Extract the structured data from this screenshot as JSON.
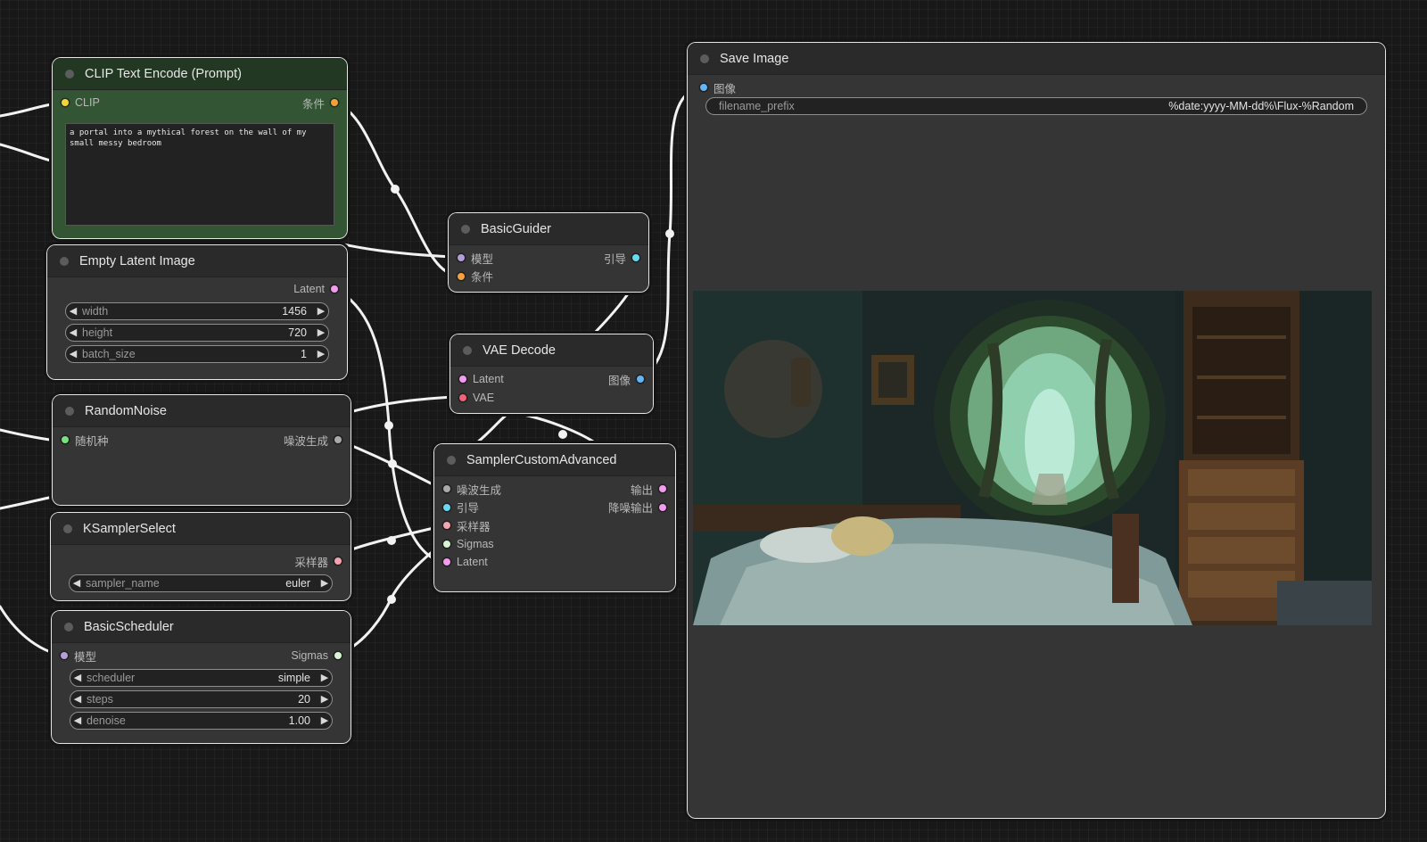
{
  "nodes": {
    "clip_text_encode": {
      "title": "CLIP Text Encode (Prompt)",
      "input": "CLIP",
      "output": "条件",
      "prompt_text": "a portal into a mythical forest on the wall of my small messy bedroom"
    },
    "empty_latent": {
      "title": "Empty Latent Image",
      "output": "Latent",
      "widgets": [
        {
          "label": "width",
          "value": "1456"
        },
        {
          "label": "height",
          "value": "720"
        },
        {
          "label": "batch_size",
          "value": "1"
        }
      ]
    },
    "random_noise": {
      "title": "RandomNoise",
      "input": "随机种",
      "output": "噪波生成"
    },
    "ksampler_select": {
      "title": "KSamplerSelect",
      "output": "采样器",
      "widgets": [
        {
          "label": "sampler_name",
          "value": "euler"
        }
      ]
    },
    "basic_scheduler": {
      "title": "BasicScheduler",
      "input": "模型",
      "output": "Sigmas",
      "widgets": [
        {
          "label": "scheduler",
          "value": "simple"
        },
        {
          "label": "steps",
          "value": "20"
        },
        {
          "label": "denoise",
          "value": "1.00"
        }
      ]
    },
    "basic_guider": {
      "title": "BasicGuider",
      "inputs": [
        "模型",
        "条件"
      ],
      "output": "引导"
    },
    "vae_decode": {
      "title": "VAE Decode",
      "inputs": [
        "Latent",
        "VAE"
      ],
      "output": "图像"
    },
    "sampler_custom_advanced": {
      "title": "SamplerCustomAdvanced",
      "inputs": [
        "噪波生成",
        "引导",
        "采样器",
        "Sigmas",
        "Latent"
      ],
      "outputs": [
        "输出",
        "降噪输出"
      ]
    },
    "save_image": {
      "title": "Save Image",
      "input": "图像",
      "filename_label": "filename_prefix",
      "filename_value": "%date:yyyy-MM-dd%\\Flux-%Random"
    }
  },
  "colors": {
    "canvas": "#181818",
    "node_body": "#353535",
    "clip_node": "#335533",
    "link": "#f2f2f2",
    "pin_clip": "#f5d33b",
    "pin_conditioning": "#f5a03a",
    "pin_latent": "#f29bf0",
    "pin_model": "#b39ddb",
    "pin_image": "#64b5f6",
    "pin_vae": "#f2637a",
    "pin_guider": "#66d9ef",
    "pin_sampler": "#f5a3b0",
    "pin_sigmas": "#d6f5d0",
    "pin_noise": "#aaaaaa",
    "pin_int": "#79e07f"
  }
}
